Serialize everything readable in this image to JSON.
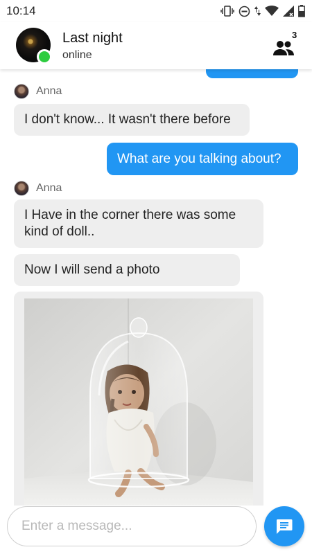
{
  "status_bar": {
    "time": "10:14"
  },
  "header": {
    "title": "Last night",
    "subtitle": "online",
    "members_count": "3",
    "online_color": "#2ecc40"
  },
  "messages": [
    {
      "type": "outgoing_partial"
    },
    {
      "type": "incoming",
      "sender": "Anna",
      "text": "I don't know... It wasn't there before"
    },
    {
      "type": "outgoing",
      "text": "What are you talking about?"
    },
    {
      "type": "incoming",
      "sender": "Anna",
      "text": "I Have in the corner there was some kind of doll.."
    },
    {
      "type": "incoming",
      "text": "Now I will send a photo"
    },
    {
      "type": "incoming_photo",
      "image": "doll-under-glass-dome"
    }
  ],
  "composer": {
    "placeholder": "Enter a message...",
    "send_icon": "message-icon"
  },
  "colors": {
    "accent": "#2196f3",
    "incoming_bubble": "#eeeeee"
  }
}
